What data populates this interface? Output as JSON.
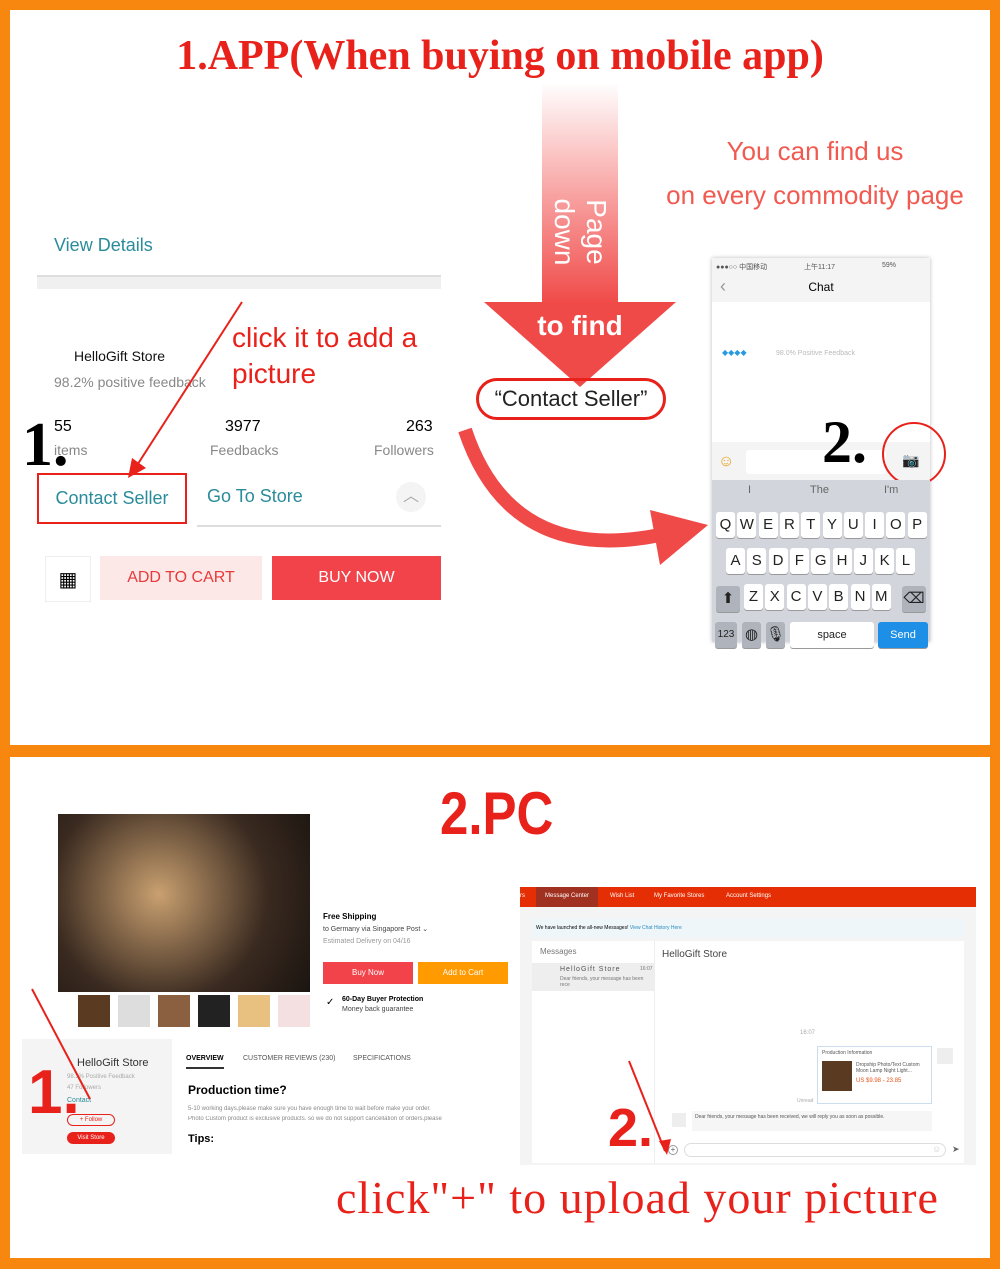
{
  "section1": {
    "title": "1.APP(When buying on mobile app)",
    "arrow_text": "Page down",
    "to_find": "to find",
    "contact_seller_quote": "“Contact Seller”",
    "find_us_line1": "You can find us",
    "find_us_line2": "on every commodity page",
    "step1": "1.",
    "step2": "2.",
    "annotation": "click it to add a picture"
  },
  "app": {
    "view_details": "View Details",
    "store_name": "HelloGift Store",
    "feedback": "98.2% positive feedback",
    "stats": [
      {
        "value": "55",
        "label": "items"
      },
      {
        "value": "3977",
        "label": "Feedbacks"
      },
      {
        "value": "263",
        "label": "Followers"
      }
    ],
    "contact_seller": "Contact Seller",
    "go_to_store": "Go To Store",
    "add_to_cart": "ADD TO CART",
    "buy_now": "BUY NOW"
  },
  "phone": {
    "status_carrier": "●●●○○ 中国移动",
    "status_time": "上午11:17",
    "status_battery": "59%",
    "title": "Chat",
    "feedback": "98.0% Positive Feedback",
    "suggestions": [
      "I",
      "The",
      "I'm"
    ],
    "rows": [
      [
        "Q",
        "W",
        "E",
        "R",
        "T",
        "Y",
        "U",
        "I",
        "O",
        "P"
      ],
      [
        "A",
        "S",
        "D",
        "F",
        "G",
        "H",
        "J",
        "K",
        "L"
      ],
      [
        "Z",
        "X",
        "C",
        "V",
        "B",
        "N",
        "M"
      ]
    ],
    "key_123": "123",
    "space": "space",
    "send": "Send"
  },
  "section2": {
    "title": "2.PC",
    "step1": "1.",
    "step2": "2.",
    "caption": "click\"+\" to upload your picture"
  },
  "product": {
    "shipping_title": "Free Shipping",
    "shipping_detail": "to Germany via Singapore Post ⌄",
    "delivery": "Estimated Delivery on 04/16",
    "buy_now": "Buy Now",
    "add_to_cart": "Add to Cart",
    "protection_title": "60-Day Buyer Protection",
    "protection_detail": "Money back guarantee"
  },
  "store_card": {
    "name": "HelloGift Store",
    "feedback": "98.3% Positive Feedback",
    "followers": "47 Followers",
    "contact": "Contact",
    "follow": "+ Follow",
    "visit": "Visit Store"
  },
  "tabs": {
    "items": [
      "OVERVIEW",
      "CUSTOMER REVIEWS (230)",
      "SPECIFICATIONS"
    ],
    "heading": "Production time?",
    "line1": "5-10 working days.please make sure you have enough time to wait before make your order.",
    "line2": "Photo Custom product is exclusive products. so we do not support cancellation of orders.please",
    "tips": "Tips:"
  },
  "messages": {
    "nav": [
      "rs",
      "Message Center",
      "Wish List",
      "My Favorite Stores",
      "Account Settings"
    ],
    "notice": "We have launched the all-new Messages!",
    "notice_link": "View Chat History Here",
    "sidebar_title": "Messages",
    "conv_name": "HelloGift Store",
    "conv_time": "16:07",
    "conv_preview": "Dear friends, your message has been rece",
    "chat_title": "HelloGift Store",
    "timestamp": "16:07",
    "card_title": "Production Information",
    "card_product": "Dropship Photo/Text Custom Moon Lamp Night Light...",
    "card_price": "US $9.98 - 23.85",
    "unread": "Unread",
    "reply": "Dear friends, your message has been received, we will reply you as soon as possible.",
    "plus": "+"
  },
  "colors": {
    "frame": "#f7870f",
    "accent_red": "#e8221b",
    "teal": "#2a8c9a",
    "aliexpress_red": "#e62e04",
    "orange_button": "#ff9a00"
  }
}
